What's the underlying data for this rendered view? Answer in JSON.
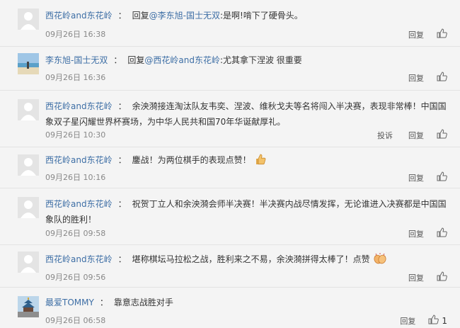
{
  "comments": [
    {
      "author": "西花岭and东花岭",
      "prefix": "回复",
      "mention": "@李东旭-国士无双",
      "body": ":是啊!啃下了硬骨头。",
      "time": "09月26日 16:38",
      "reply_label": "回复",
      "avatar": "default"
    },
    {
      "author": "李东旭-国士无双",
      "prefix": "回复",
      "mention": "@西花岭and东花岭",
      "body": ":尤其拿下涅波 很重要",
      "time": "09月26日 16:36",
      "reply_label": "回复",
      "avatar": "photo-beach"
    },
    {
      "author": "西花岭and东花岭",
      "body": "余泱漪接连淘汰队友韦奕、涅波、维秋戈夫等名将闯入半决赛，表现非常棒！中国国象双子星闪耀世界杯赛场，为中华人民共和国70年华诞献厚礼。",
      "time": "09月26日 10:30",
      "report_label": "投诉",
      "reply_label": "回复",
      "avatar": "default"
    },
    {
      "author": "西花岭and东花岭",
      "body": "鏖战！为两位棋手的表现点赞！",
      "emoji": "thumbs-up-emoji",
      "time": "09月26日 10:16",
      "reply_label": "回复",
      "avatar": "default"
    },
    {
      "author": "西花岭and东花岭",
      "body": "祝贺丁立人和余泱漪会师半决赛！半决赛内战尽情发挥，无论谁进入决赛都是中国国象队的胜利！",
      "time": "09月26日 09:58",
      "reply_label": "回复",
      "avatar": "default"
    },
    {
      "author": "西花岭and东花岭",
      "body": "堪称棋坛马拉松之战，胜利来之不易，余泱漪拼得太棒了！点赞",
      "emoji": "clap-emoji",
      "time": "09月26日 09:56",
      "reply_label": "回复",
      "avatar": "default"
    },
    {
      "author": "最爱TOMMY",
      "body": "靠意志战胜对手",
      "time": "09月26日 06:58",
      "reply_label": "回复",
      "like_count": "1",
      "avatar": "photo-temple"
    }
  ]
}
